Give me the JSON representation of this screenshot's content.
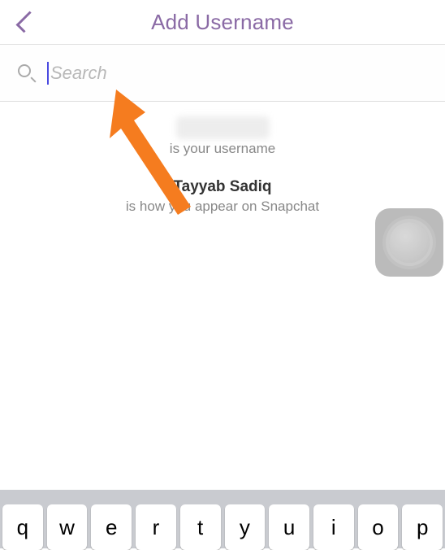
{
  "header": {
    "title": "Add Username"
  },
  "search": {
    "placeholder": "Search",
    "value": ""
  },
  "info": {
    "username_label": "is your username",
    "display_name": "Tayyab Sadiq",
    "display_label": "is how you appear on Snapchat"
  },
  "keyboard": {
    "row1": [
      "q",
      "w",
      "e",
      "r",
      "t",
      "y",
      "u",
      "i",
      "o",
      "p"
    ]
  },
  "colors": {
    "accent": "#8a6aa5",
    "arrow": "#f57c1f"
  }
}
